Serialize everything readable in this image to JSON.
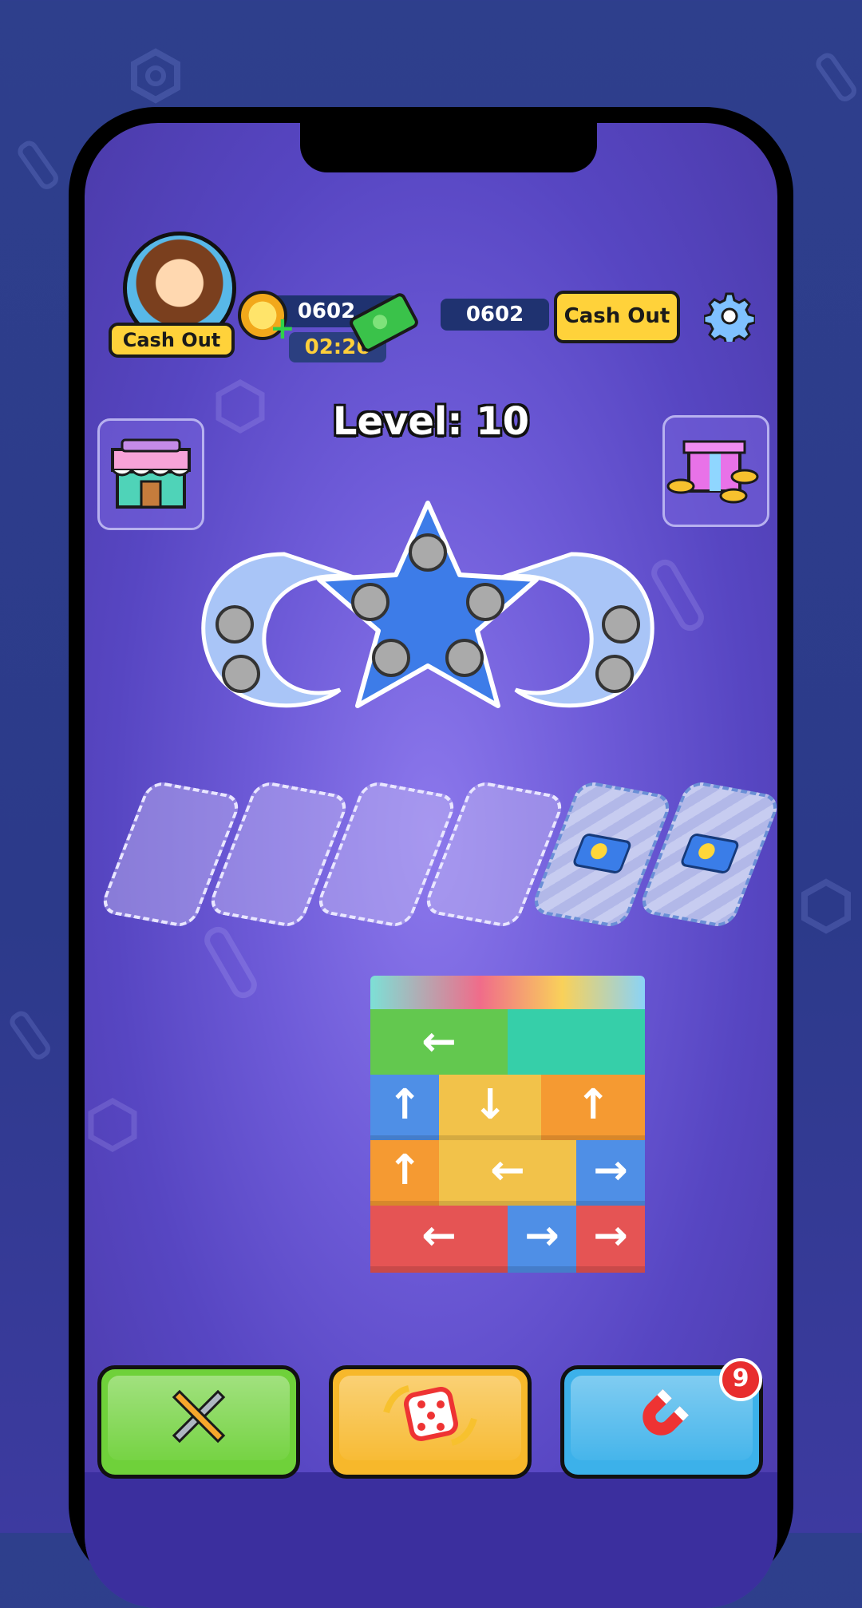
{
  "header": {
    "avatar_cash_label": "Cash Out",
    "coins": "0602",
    "timer": "02:26",
    "cash_amount": "0602",
    "cash_out_label": "Cash Out"
  },
  "level_label": "Level: 10",
  "slots": [
    {
      "locked": false
    },
    {
      "locked": false
    },
    {
      "locked": false
    },
    {
      "locked": false
    },
    {
      "locked": true,
      "icon": "video-icon"
    },
    {
      "locked": true,
      "icon": "video-icon"
    }
  ],
  "block_rows": [
    [
      {
        "color": "#63c84f",
        "arrow": "←"
      },
      {
        "color": "#36cfa9",
        "arrow": ""
      }
    ],
    [
      {
        "color": "#4f8fe6",
        "arrow": "↑"
      },
      {
        "color": "#f2c24a",
        "arrow": "↓"
      },
      {
        "color": "#f59a32",
        "arrow": "↑"
      }
    ],
    [
      {
        "color": "#f59a32",
        "arrow": "↑"
      },
      {
        "color": "#f2c24a",
        "arrow": "←"
      },
      {
        "color": "#4f8fe6",
        "arrow": "→"
      }
    ],
    [
      {
        "color": "#e55454",
        "arrow": "←"
      },
      {
        "color": "#4f8fe6",
        "arrow": "→"
      },
      {
        "color": "#e55454",
        "arrow": "→"
      }
    ]
  ],
  "boosters": [
    {
      "name": "tools",
      "icon": "tools-icon",
      "color": "#6fd13a"
    },
    {
      "name": "shuffle",
      "icon": "dice-icon",
      "color": "#f7b82b"
    },
    {
      "name": "magnet",
      "icon": "magnet-icon",
      "color": "#3cb1ea",
      "badge": "9"
    }
  ]
}
